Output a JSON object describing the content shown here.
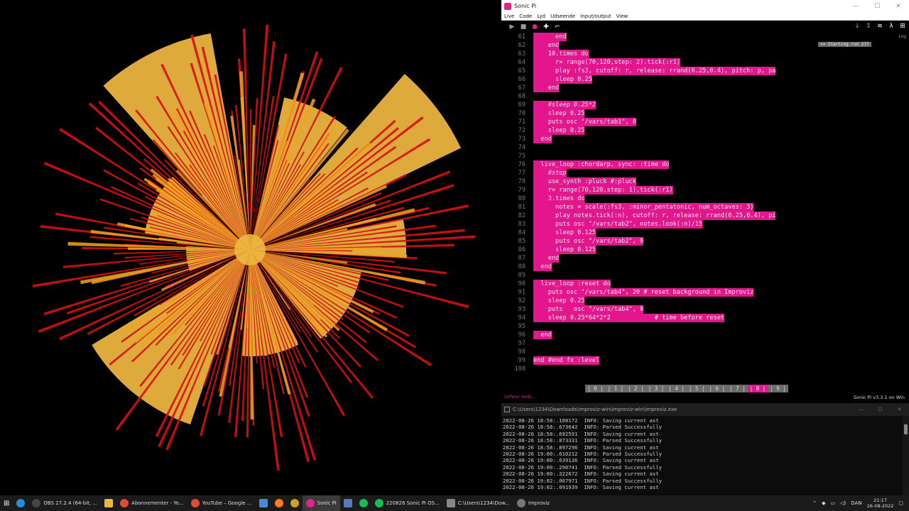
{
  "sonic_pi": {
    "window_title": "Sonic Pi",
    "menu": [
      "Live",
      "Code",
      "Lyd",
      "Udseende",
      "Input/output",
      "View"
    ],
    "log_title": "Log",
    "log_message": "=> Starting run 277",
    "status_left": "Udfører kode...",
    "status_right": "Sonic Pi v3.3.1 on Win",
    "buffer_tabs": [
      "| 0 |",
      "| 1 |",
      "| 2 |",
      "| 3 |",
      "| 4 |",
      "| 5 |",
      "| 6 |",
      "| 7 |",
      "| 8 |",
      "| 9 |"
    ],
    "active_tab": 8,
    "code_lines": [
      {
        "n": "61",
        "t": "      end"
      },
      {
        "n": "62",
        "t": "    end"
      },
      {
        "n": "63",
        "t": "    10.times do"
      },
      {
        "n": "64",
        "t": "      r= range(70,120,step: 2).tick(:r1)"
      },
      {
        "n": "65",
        "t": "      play :fs3, cutoff: r, release: rrand(0.25,0.4), pitch: p, pa"
      },
      {
        "n": "66",
        "t": "      sleep 0.25"
      },
      {
        "n": "67",
        "t": "    end"
      },
      {
        "n": "68",
        "t": ""
      },
      {
        "n": "69",
        "t": "    #sleep 0.25*2"
      },
      {
        "n": "70",
        "t": "    sleep 0.25"
      },
      {
        "n": "71",
        "t": "    puts osc \"/vars/tab1\", 0"
      },
      {
        "n": "72",
        "t": "    sleep 0.25"
      },
      {
        "n": "73",
        "t": "  end"
      },
      {
        "n": "74",
        "t": ""
      },
      {
        "n": "75",
        "t": ""
      },
      {
        "n": "76",
        "t": "  live_loop :chordarp, sync: :time do"
      },
      {
        "n": "77",
        "t": "    #stop"
      },
      {
        "n": "78",
        "t": "    use_synth :pluck #:pluck"
      },
      {
        "n": "79",
        "t": "    r= range(70,120,step: 1).tick(:r1)"
      },
      {
        "n": "80",
        "t": "    3.times do"
      },
      {
        "n": "81",
        "t": "      notes = scale(:fs3, :minor_pentatonic, num_octaves: 3)"
      },
      {
        "n": "82",
        "t": "      play notes.tick(:n), cutoff: r, release: rrand(0.25,0.4), pi"
      },
      {
        "n": "83",
        "t": "      puts osc \"/vars/tab2\", notes.look(:n)/15"
      },
      {
        "n": "84",
        "t": "      sleep 0.125"
      },
      {
        "n": "85",
        "t": "      puts osc \"/vars/tab2\", 0"
      },
      {
        "n": "86",
        "t": "      sleep 0.125"
      },
      {
        "n": "87",
        "t": "    end"
      },
      {
        "n": "88",
        "t": "  end"
      },
      {
        "n": "89",
        "t": ""
      },
      {
        "n": "90",
        "t": "  live_loop :reset do"
      },
      {
        "n": "91",
        "t": "    puts osc \"/vars/tab4\", 20 # reset background in Improviz"
      },
      {
        "n": "92",
        "t": "    sleep 0.25"
      },
      {
        "n": "93",
        "t": "    puts   osc \"/vars/tab4\", 0"
      },
      {
        "n": "94",
        "t": "    sleep 0.25*64*2*2            # time before reset"
      },
      {
        "n": "95",
        "t": ""
      },
      {
        "n": "96",
        "t": "  end"
      },
      {
        "n": "97",
        "t": ""
      },
      {
        "n": "98",
        "t": ""
      },
      {
        "n": "99",
        "t": "end #end fx :level"
      },
      {
        "n": "100",
        "t": ""
      }
    ]
  },
  "console": {
    "title": "C:\\Users\\1234\\Downloads\\improviz-win\\improviz-win\\improviz.exe",
    "lines": [
      "2022-08-26 18:58:.108172  INFO: Saving current ast",
      "2022-08-26 18:58:.673642  INFO: Parsed Successfully",
      "2022-08-26 18:58:.692591  INFO: Saving current ast",
      "2022-08-26 18:58:.873331  INFO: Parsed Successfully",
      "2022-08-26 18:58:.897296  INFO: Saving current ast",
      "2022-08-26 19:00:.610212  INFO: Parsed Successfully",
      "2022-08-26 19:00:.639136  INFO: Saving current ast",
      "2022-08-26 19:00:.290741  INFO: Parsed Successfully",
      "2022-08-26 19:00:.322672  INFO: Saving current ast",
      "2022-08-26 19:02:.067971  INFO: Parsed Successfully",
      "2022-08-26 19:02:.091939  INFO: Saving current ast"
    ]
  },
  "taskbar": {
    "items": [
      {
        "label": "OBS 27.2.4 (64-bit, ...",
        "icon": "obs-icon",
        "color": "#444"
      },
      {
        "label": "",
        "icon": "folder-icon",
        "color": "#e8b93a"
      },
      {
        "label": "Abonnementer - Yo...",
        "icon": "chrome-icon",
        "color": "#dd4b39"
      },
      {
        "label": "YouTube – Google ...",
        "icon": "chrome-icon",
        "color": "#dd4b39"
      },
      {
        "label": "",
        "icon": "notepad-icon",
        "color": "#4a8ad4"
      },
      {
        "label": "",
        "icon": "firefox-icon",
        "color": "#ff7a1a"
      },
      {
        "label": "",
        "icon": "winamp-icon",
        "color": "#c9a227"
      },
      {
        "label": "Sonic Pi",
        "icon": "sonic-pi-icon",
        "color": "#e0248a"
      },
      {
        "label": "",
        "icon": "app-icon",
        "color": "#5a7ab5"
      },
      {
        "label": "",
        "icon": "spotify-icon",
        "color": "#1db954"
      },
      {
        "label": "220826 Sonic Pi OS...",
        "icon": "media-icon",
        "color": "#1db954"
      },
      {
        "label": "C:\\Users\\1234\\Dow...",
        "icon": "terminal-icon",
        "color": "#888"
      },
      {
        "label": "Improviz",
        "icon": "improviz-icon",
        "color": "#777"
      }
    ],
    "language": "DAN",
    "time": "21:17",
    "date": "26-08-2022"
  },
  "colors": {
    "highlight": "#e4168e",
    "viz_red": "#d81010",
    "viz_orange": "#f4a21c",
    "viz_gold": "#f0b840"
  }
}
